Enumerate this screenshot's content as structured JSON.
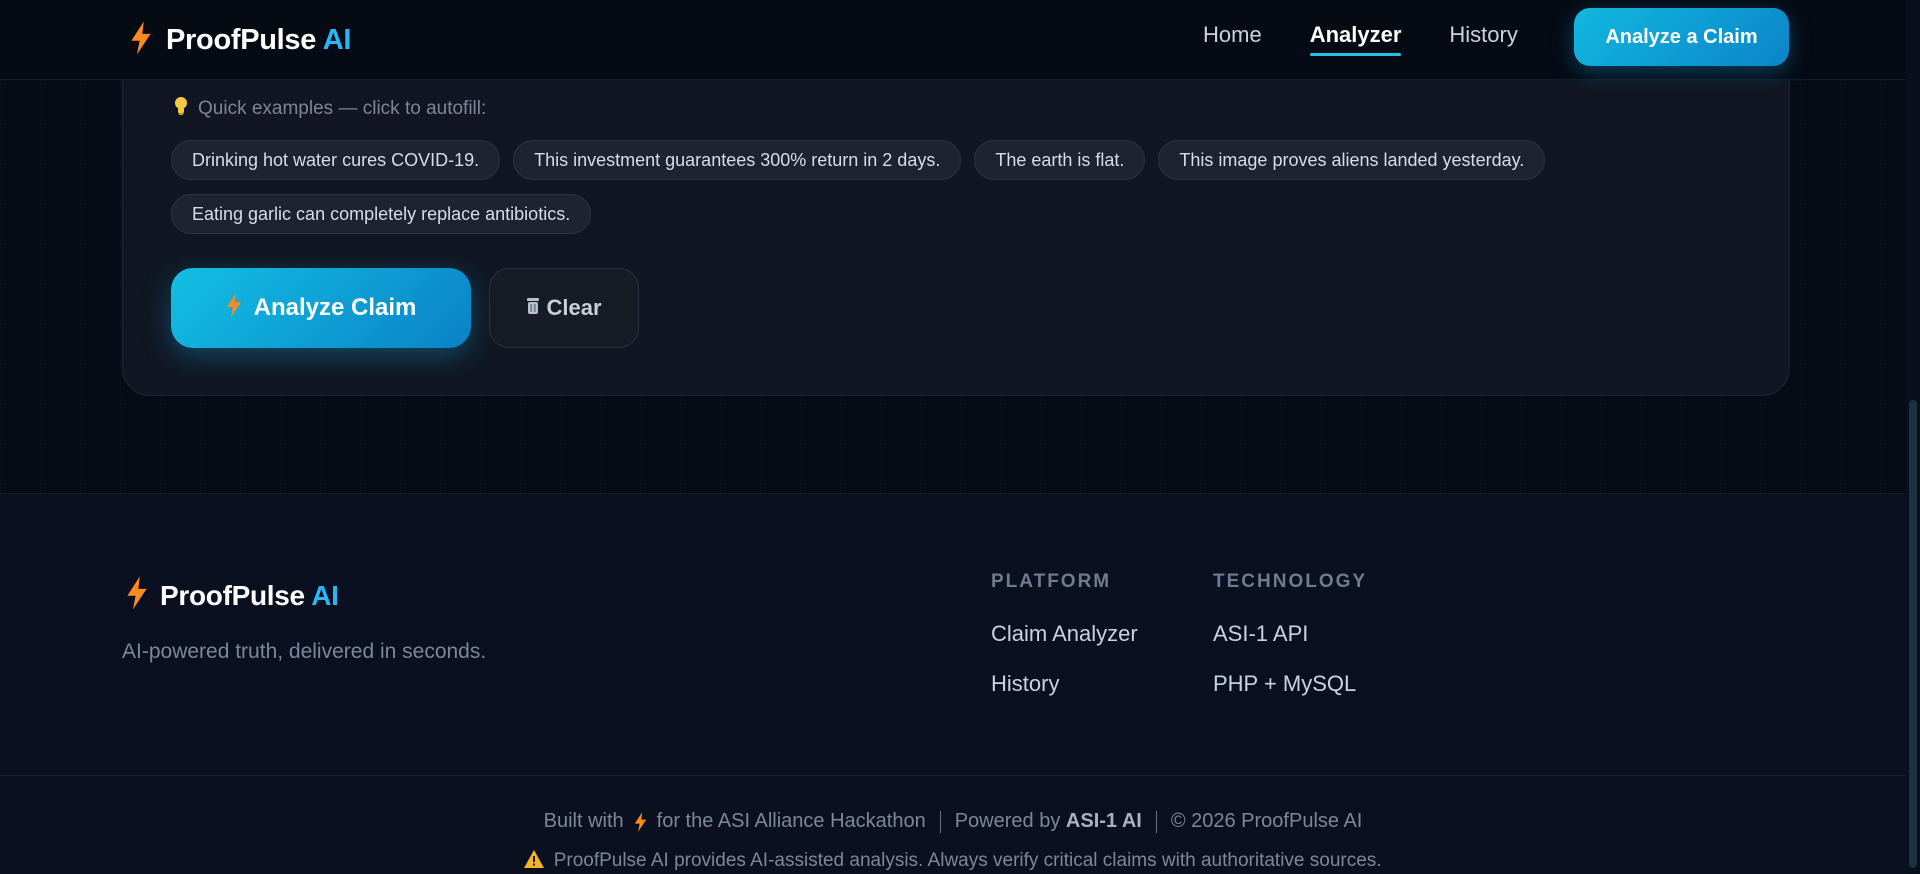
{
  "colors": {
    "accent": "#22c4e6",
    "brand_ai": "#29b6f6",
    "bolt": "#ff8a1f",
    "background": "#070b16"
  },
  "nav": {
    "brand_name": "ProofPulse",
    "brand_ai": "AI",
    "links": [
      {
        "label": "Home",
        "active": false
      },
      {
        "label": "Analyzer",
        "active": true
      },
      {
        "label": "History",
        "active": false
      }
    ],
    "cta_label": "Analyze a Claim"
  },
  "analyzer": {
    "examples_label": "Quick examples — click to autofill:",
    "examples_icon": "lightbulb-icon",
    "examples": [
      "Drinking hot water cures COVID-19.",
      "This investment guarantees 300% return in 2 days.",
      "The earth is flat.",
      "This image proves aliens landed yesterday.",
      "Eating garlic can completely replace antibiotics."
    ],
    "analyze_label": "Analyze Claim",
    "clear_label": "Clear",
    "clear_icon": "trash-icon"
  },
  "footer": {
    "brand_name": "ProofPulse",
    "brand_ai": "AI",
    "tagline": "AI-powered truth, delivered in seconds.",
    "platform": {
      "heading": "PLATFORM",
      "links": [
        "Claim Analyzer",
        "History"
      ]
    },
    "technology": {
      "heading": "TECHNOLOGY",
      "links": [
        "ASI-1 API",
        "PHP + MySQL"
      ]
    },
    "bottom": {
      "built_prefix": "Built with",
      "built_suffix": "for the ASI Alliance Hackathon",
      "powered_prefix": "Powered by",
      "powered_name": "ASI-1 AI",
      "copyright": "© 2026 ProofPulse AI"
    },
    "disclaimer": "ProofPulse AI provides AI-assisted analysis. Always verify critical claims with authoritative sources."
  }
}
